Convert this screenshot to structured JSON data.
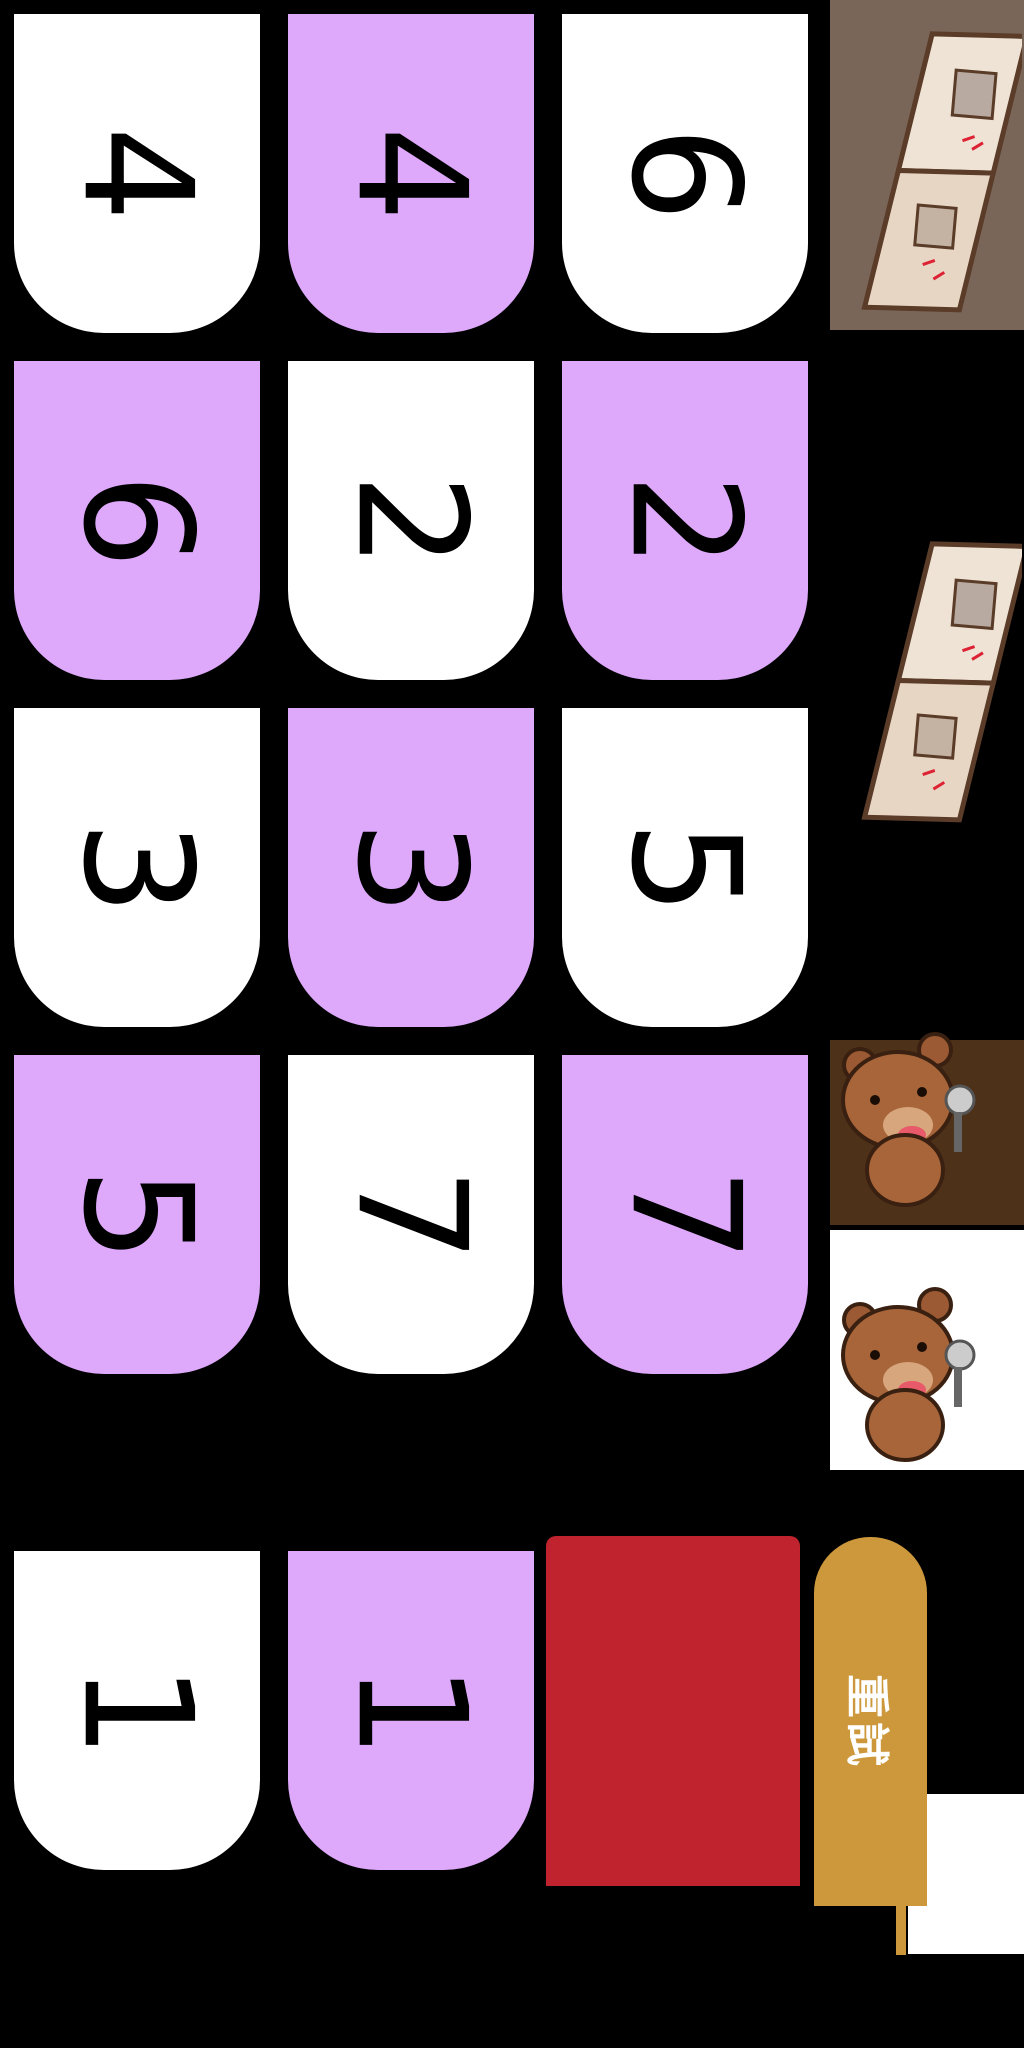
{
  "cards": [
    {
      "value": "4",
      "color": "white"
    },
    {
      "value": "4",
      "color": "purple"
    },
    {
      "value": "6",
      "color": "white"
    },
    {
      "value": "6",
      "color": "purple"
    },
    {
      "value": "2",
      "color": "white"
    },
    {
      "value": "2",
      "color": "purple"
    },
    {
      "value": "3",
      "color": "white"
    },
    {
      "value": "3",
      "color": "purple"
    },
    {
      "value": "5",
      "color": "white"
    },
    {
      "value": "5",
      "color": "purple"
    },
    {
      "value": "7",
      "color": "white"
    },
    {
      "value": "7",
      "color": "purple"
    },
    {
      "value": "1",
      "color": "white"
    },
    {
      "value": "1",
      "color": "purple"
    }
  ],
  "retry_label": "重試",
  "icons": [
    "open-book-icon",
    "open-book-icon",
    "bear-microphone-icon",
    "bear-microphone-icon"
  ],
  "colors": {
    "card_white": "#ffffff",
    "card_purple": "#dea8fb",
    "red_panel": "#c0232e",
    "retry": "#cd983c",
    "background": "#000000"
  }
}
